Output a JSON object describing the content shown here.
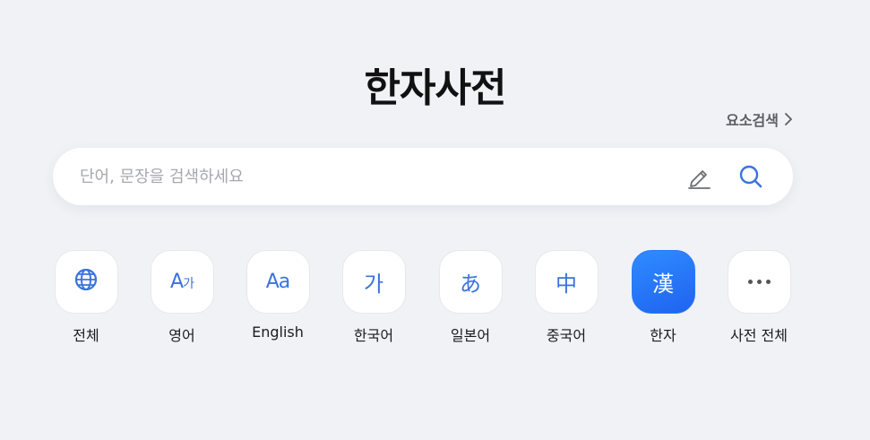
{
  "title": "한자사전",
  "element_search": {
    "label": "요소검색",
    "icon": "chevron-right-icon"
  },
  "search": {
    "placeholder": "단어, 문장을 검색하세요",
    "value": "",
    "handwriting_icon": "pen-icon",
    "search_icon": "search-icon"
  },
  "categories": [
    {
      "label": "전체",
      "glyph": "",
      "icon": "globe-icon",
      "active": false
    },
    {
      "label": "영어",
      "glyph": "A",
      "glyph_small": "가",
      "icon": "english-korean-icon",
      "active": false
    },
    {
      "label": "English",
      "glyph": "Aa",
      "icon": "english-icon",
      "active": false
    },
    {
      "label": "한국어",
      "glyph": "가",
      "icon": "korean-icon",
      "active": false
    },
    {
      "label": "일본어",
      "glyph": "あ",
      "icon": "japanese-icon",
      "active": false
    },
    {
      "label": "중국어",
      "glyph": "中",
      "icon": "chinese-icon",
      "active": false
    },
    {
      "label": "한자",
      "glyph": "漢",
      "icon": "hanja-icon",
      "active": true
    },
    {
      "label": "사전 전체",
      "glyph": "",
      "icon": "more-icon",
      "active": false
    }
  ],
  "colors": {
    "background": "#f1f2f6",
    "accent": "#3b72de",
    "active_from": "#2f8cff",
    "active_to": "#1f63f0"
  }
}
